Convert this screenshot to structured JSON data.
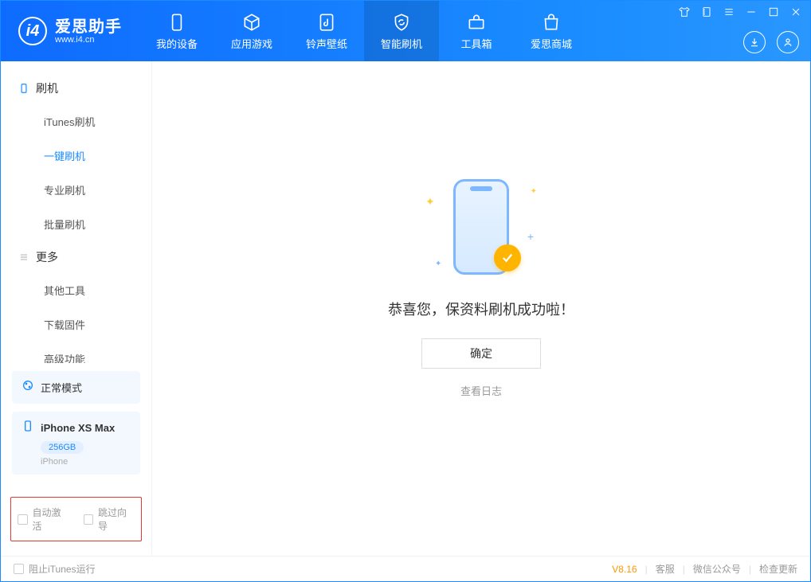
{
  "brand": {
    "name": "爱思助手",
    "site": "www.i4.cn"
  },
  "nav": [
    {
      "label": "我的设备"
    },
    {
      "label": "应用游戏"
    },
    {
      "label": "铃声壁纸"
    },
    {
      "label": "智能刷机"
    },
    {
      "label": "工具箱"
    },
    {
      "label": "爱思商城"
    }
  ],
  "sidebar": {
    "group1": {
      "title": "刷机",
      "items": [
        "iTunes刷机",
        "一键刷机",
        "专业刷机",
        "批量刷机"
      ]
    },
    "group2": {
      "title": "更多",
      "items": [
        "其他工具",
        "下载固件",
        "高级功能"
      ]
    }
  },
  "status": {
    "mode": "正常模式",
    "device": "iPhone XS Max",
    "capacity": "256GB",
    "device_type": "iPhone"
  },
  "options": {
    "auto_activate": "自动激活",
    "skip_guide": "跳过向导"
  },
  "main": {
    "success_text": "恭喜您，保资料刷机成功啦！",
    "ok_button": "确定",
    "log_link": "查看日志"
  },
  "footer": {
    "block_itunes": "阻止iTunes运行",
    "version": "V8.16",
    "links": [
      "客服",
      "微信公众号",
      "检查更新"
    ]
  }
}
